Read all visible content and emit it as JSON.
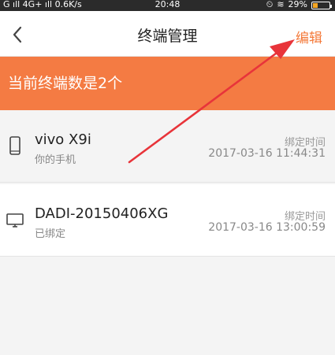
{
  "status_bar": {
    "signal": "G ıll 4G+ ıll",
    "speed": "0.6K/s",
    "time": "20:48",
    "battery": "29%",
    "battery_level": 0.29
  },
  "nav": {
    "back_icon": "chevron-left-icon",
    "title": "终端管理",
    "edit_label": "编辑"
  },
  "banner": {
    "text": "当前终端数是2个"
  },
  "devices": [
    {
      "name": "vivo X9i",
      "subtitle": "你的手机",
      "icon": "phone-icon",
      "bind_label": "绑定时间",
      "bind_time": "2017-03-16 11:44:31"
    },
    {
      "name": "DADI-20150406XG",
      "subtitle": "已绑定",
      "icon": "monitor-icon",
      "bind_label": "绑定时间",
      "bind_time": "2017-03-16 13:00:59"
    }
  ],
  "colors": {
    "accent": "#f47b43",
    "annotation_arrow": "#e8343a"
  }
}
